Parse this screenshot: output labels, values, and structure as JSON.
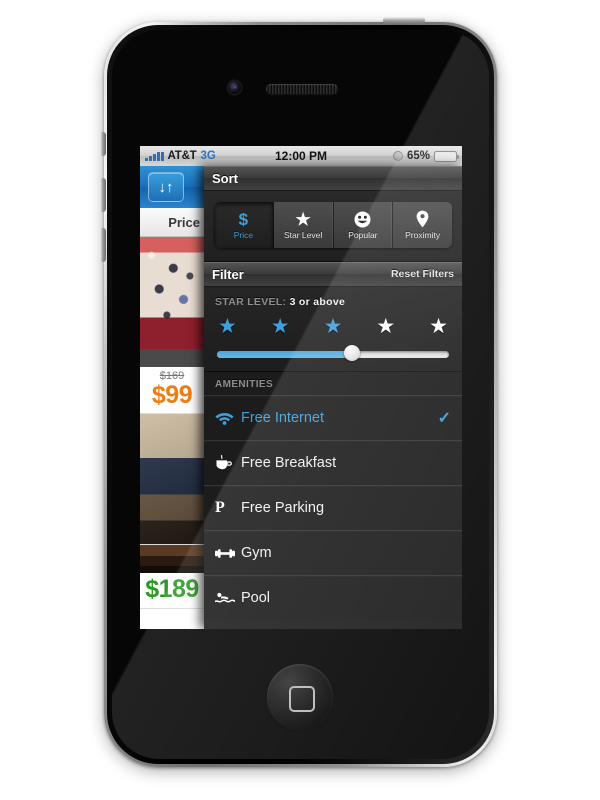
{
  "device": {
    "name": "iPhone 4",
    "home_button": "home-button"
  },
  "status_bar": {
    "carrier": "AT&T",
    "network": "3G",
    "time": "12:00 PM",
    "battery_percent": "65%",
    "battery_level": 65,
    "lock_icon": "rotation-lock-icon",
    "signal_icon": "signal-bars-icon"
  },
  "list_column": {
    "sort_toggle_icon": "sort-ascending-descending-icon",
    "sort_toggle_glyph": "↓↑",
    "column_header": "Price",
    "hotels": [
      {
        "photo": "hotel-lobby-photo",
        "price_old": "$169",
        "price_new": "$99",
        "price_color": "#f07d12"
      },
      {
        "photo": "hotel-room-desk-photo",
        "price_old": "",
        "price_new": "",
        "price_color": ""
      },
      {
        "photo": "hotel-interior-photo",
        "price_old": "",
        "price_new": "$189",
        "price_color": "#2a9a22"
      }
    ]
  },
  "sort_panel": {
    "title": "Sort",
    "options": [
      {
        "label": "Price",
        "icon": "dollar-sign-icon",
        "glyph": "$",
        "selected": true
      },
      {
        "label": "Star Level",
        "icon": "star-icon",
        "glyph": "★",
        "selected": false
      },
      {
        "label": "Popular",
        "icon": "smiley-face-icon",
        "glyph": "☻",
        "selected": false
      },
      {
        "label": "Proximity",
        "icon": "map-pin-icon",
        "glyph": "•",
        "selected": false
      }
    ]
  },
  "filter_panel": {
    "title": "Filter",
    "reset_label": "Reset Filters",
    "star_level": {
      "label": "STAR LEVEL:",
      "value": "3 or above",
      "filled_stars": 3,
      "total_stars": 5,
      "slider_percent": 58
    },
    "amenities": {
      "header": "AMENITIES",
      "items": [
        {
          "label": "Free Internet",
          "icon": "wifi-icon",
          "selected": true,
          "check": "✓"
        },
        {
          "label": "Free Breakfast",
          "icon": "coffee-cup-icon",
          "selected": false,
          "check": ""
        },
        {
          "label": "Free Parking",
          "icon": "parking-p-icon",
          "selected": false,
          "check": ""
        },
        {
          "label": "Gym",
          "icon": "dumbbell-icon",
          "selected": false,
          "check": ""
        },
        {
          "label": "Pool",
          "icon": "swimmer-icon",
          "selected": false,
          "check": ""
        }
      ]
    }
  },
  "colors": {
    "accent_blue": "#3f9fdc",
    "price_orange": "#f07d12",
    "price_green": "#2a9a22",
    "panel_bg": "#1c1c1c"
  }
}
